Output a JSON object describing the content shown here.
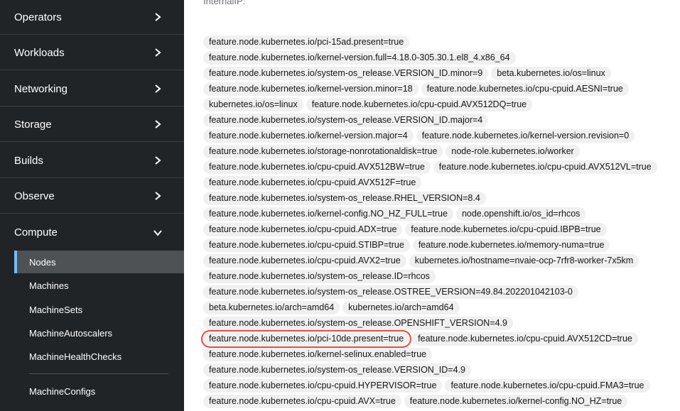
{
  "sidebar": {
    "sections": [
      {
        "label": "Operators",
        "expanded": false
      },
      {
        "label": "Workloads",
        "expanded": false
      },
      {
        "label": "Networking",
        "expanded": false
      },
      {
        "label": "Storage",
        "expanded": false
      },
      {
        "label": "Builds",
        "expanded": false
      },
      {
        "label": "Observe",
        "expanded": false
      },
      {
        "label": "Compute",
        "expanded": true
      }
    ],
    "compute_items": [
      {
        "label": "Nodes",
        "active": true
      },
      {
        "label": "Machines",
        "active": false
      },
      {
        "label": "MachineSets",
        "active": false
      },
      {
        "label": "MachineAutoscalers",
        "active": false
      },
      {
        "label": "MachineHealthChecks",
        "active": false
      },
      {
        "label": "MachineConfigs",
        "active": false
      }
    ]
  },
  "main": {
    "top_text": "InternalIP:",
    "highlighted_label": "feature.node.kubernetes.io/pci-10de.present=true",
    "label_rows": [
      [
        "feature.node.kubernetes.io/pci-15ad.present=true"
      ],
      [
        "feature.node.kubernetes.io/kernel-version.full=4.18.0-305.30.1.el8_4.x86_64"
      ],
      [
        "feature.node.kubernetes.io/system-os_release.VERSION_ID.minor=9",
        "beta.kubernetes.io/os=linux"
      ],
      [
        "feature.node.kubernetes.io/kernel-version.minor=18",
        "feature.node.kubernetes.io/cpu-cpuid.AESNI=true"
      ],
      [
        "kubernetes.io/os=linux",
        "feature.node.kubernetes.io/cpu-cpuid.AVX512DQ=true"
      ],
      [
        "feature.node.kubernetes.io/system-os_release.VERSION_ID.major=4"
      ],
      [
        "feature.node.kubernetes.io/kernel-version.major=4",
        "feature.node.kubernetes.io/kernel-version.revision=0"
      ],
      [
        "feature.node.kubernetes.io/storage-nonrotationaldisk=true",
        "node-role.kubernetes.io/worker"
      ],
      [
        "feature.node.kubernetes.io/cpu-cpuid.AVX512BW=true",
        "feature.node.kubernetes.io/cpu-cpuid.AVX512VL=true"
      ],
      [
        "feature.node.kubernetes.io/cpu-cpuid.AVX512F=true"
      ],
      [
        "feature.node.kubernetes.io/system-os_release.RHEL_VERSION=8.4"
      ],
      [
        "feature.node.kubernetes.io/kernel-config.NO_HZ_FULL=true",
        "node.openshift.io/os_id=rhcos"
      ],
      [
        "feature.node.kubernetes.io/cpu-cpuid.ADX=true",
        "feature.node.kubernetes.io/cpu-cpuid.IBPB=true"
      ],
      [
        "feature.node.kubernetes.io/cpu-cpuid.STIBP=true",
        "feature.node.kubernetes.io/memory-numa=true"
      ],
      [
        "feature.node.kubernetes.io/cpu-cpuid.AVX2=true",
        "kubernetes.io/hostname=nvaie-ocp-7rfr8-worker-7x5km"
      ],
      [
        "feature.node.kubernetes.io/system-os_release.ID=rhcos"
      ],
      [
        "feature.node.kubernetes.io/system-os_release.OSTREE_VERSION=49.84.202201042103-0"
      ],
      [
        "beta.kubernetes.io/arch=amd64",
        "kubernetes.io/arch=amd64"
      ],
      [
        "feature.node.kubernetes.io/system-os_release.OPENSHIFT_VERSION=4.9"
      ],
      [
        "feature.node.kubernetes.io/pci-10de.present=true",
        "feature.node.kubernetes.io/cpu-cpuid.AVX512CD=true"
      ],
      [
        "feature.node.kubernetes.io/kernel-selinux.enabled=true"
      ],
      [
        "feature.node.kubernetes.io/system-os_release.VERSION_ID=4.9"
      ],
      [
        "feature.node.kubernetes.io/cpu-cpuid.HYPERVISOR=true",
        "feature.node.kubernetes.io/cpu-cpuid.FMA3=true"
      ],
      [
        "feature.node.kubernetes.io/cpu-cpuid.AVX=true",
        "feature.node.kubernetes.io/kernel-config.NO_HZ=true"
      ]
    ]
  },
  "colors": {
    "sidebar_bg": "#212427",
    "active_item_bg": "#4f5255",
    "active_item_border": "#73bcf7",
    "chip_bg": "#f0f0f0",
    "highlight": "#e74c3c"
  }
}
